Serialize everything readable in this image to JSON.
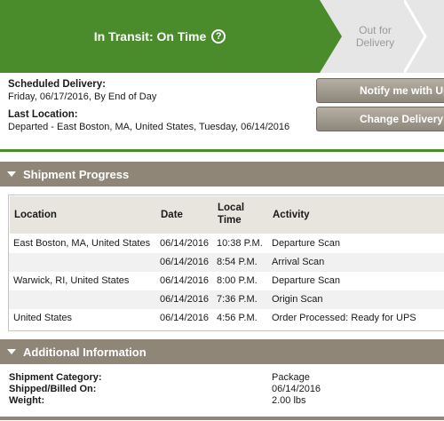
{
  "status": {
    "current_stage": "In Transit: On Time",
    "next_stage": "Out for\nDelivery",
    "colors": {
      "active": "#4a8b2c",
      "inactive": "#e6e6e6",
      "section": "#8f8677"
    }
  },
  "delivery": {
    "scheduled_title": "Scheduled Delivery:",
    "scheduled_value": "Friday, 06/17/2016, By End of Day",
    "last_location_title": "Last Location:",
    "last_location_value": "Departed - East Boston, MA, United States, Tuesday, 06/14/2016",
    "notify_button": "Notify me with Updates",
    "change_button": "Change Delivery"
  },
  "progress": {
    "section_title": "Shipment Progress",
    "columns": [
      "Location",
      "Date",
      "Local Time",
      "Activity"
    ],
    "rows": [
      {
        "location": "East Boston, MA, United States",
        "date": "06/14/2016",
        "time": "10:38 P.M.",
        "activity": "Departure Scan"
      },
      {
        "location": "",
        "date": "06/14/2016",
        "time": "8:54 P.M.",
        "activity": "Arrival Scan"
      },
      {
        "location": "Warwick, RI, United States",
        "date": "06/14/2016",
        "time": "8:00 P.M.",
        "activity": "Departure Scan"
      },
      {
        "location": "",
        "date": "06/14/2016",
        "time": "7:36 P.M.",
        "activity": "Origin Scan"
      },
      {
        "location": "United States",
        "date": "06/14/2016",
        "time": "4:56 P.M.",
        "activity": "Order Processed: Ready for UPS"
      }
    ]
  },
  "additional": {
    "section_title": "Additional Information",
    "items": [
      {
        "label": "Shipment Category:",
        "value": "Package"
      },
      {
        "label": "Shipped/Billed On:",
        "value": "06/14/2016"
      },
      {
        "label": "Weight:",
        "value": "2.00 lbs"
      }
    ]
  }
}
